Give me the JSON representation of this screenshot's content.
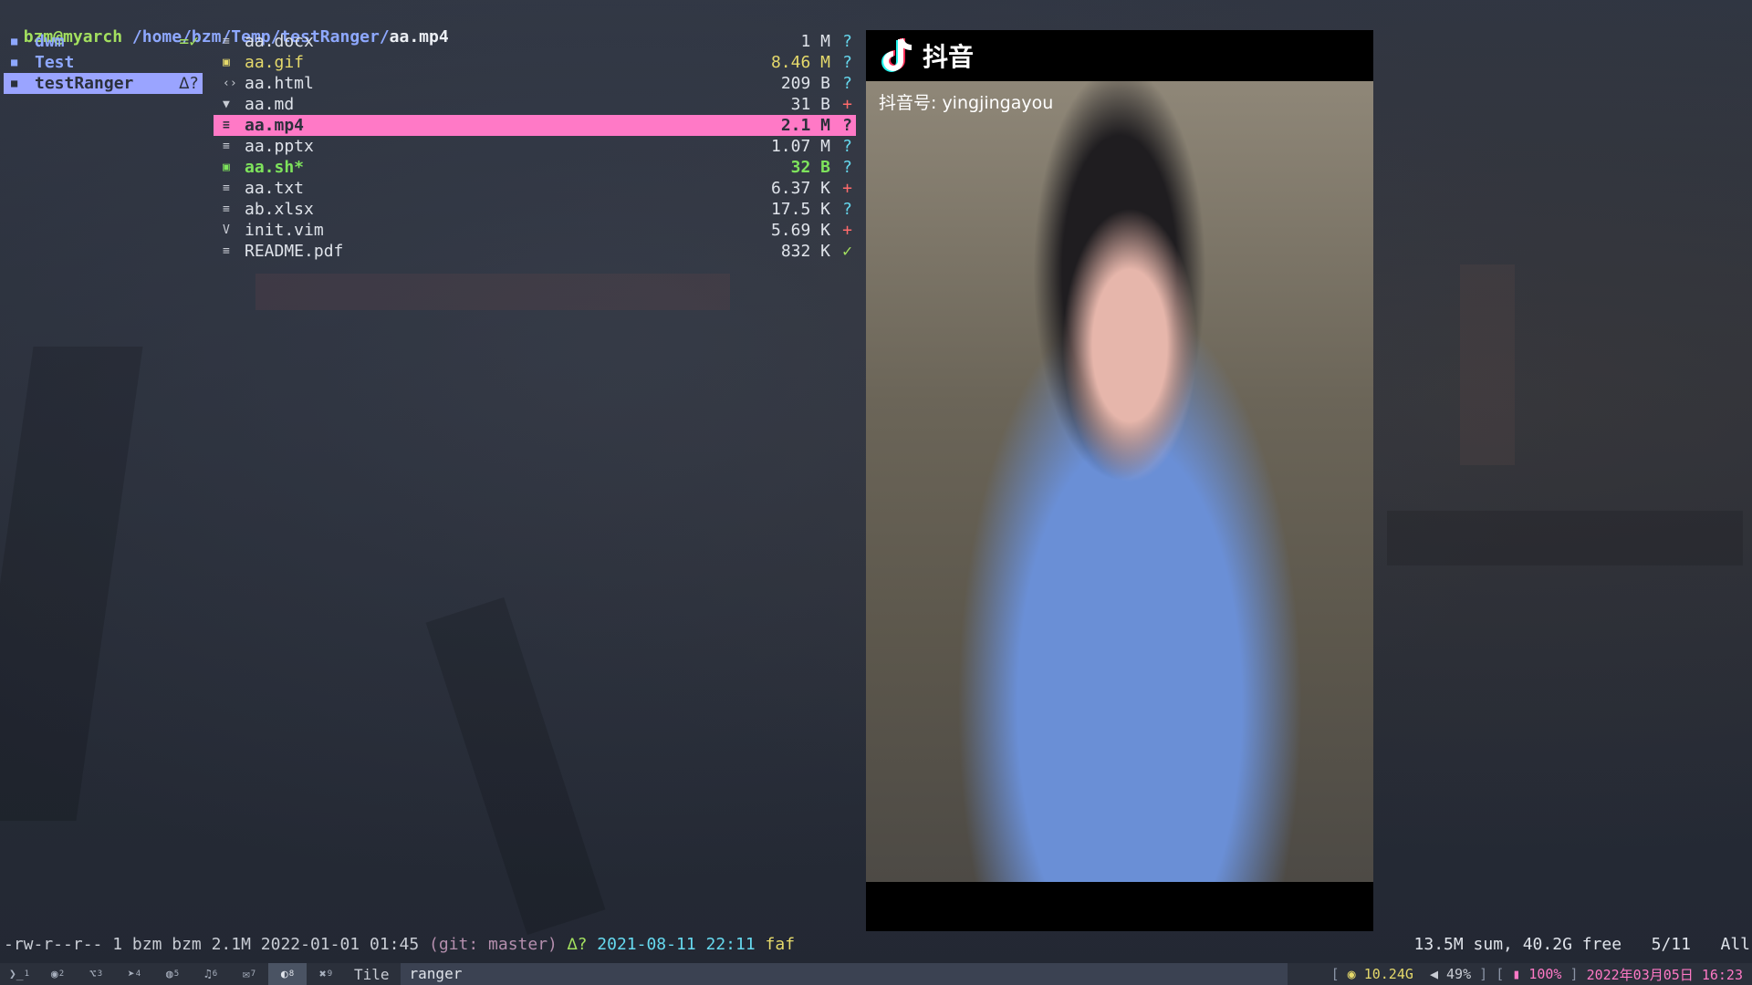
{
  "titlebar": {
    "user_host": "bzm@myarch",
    "dir_path": "/home/bzm/Temp/testRanger/",
    "current_file": "aa.mp4"
  },
  "parent_column": [
    {
      "name": "dwm",
      "tag": "=✓",
      "icon": "folder-icon"
    },
    {
      "name": "Test",
      "tag": "",
      "icon": "folder-icon"
    },
    {
      "name": "testRanger",
      "tag": "∆?",
      "icon": "folder-icon",
      "selected": true
    }
  ],
  "files": [
    {
      "name": "aa.docx",
      "size": "1 M",
      "git": "?",
      "icon": "document-icon"
    },
    {
      "name": "aa.gif",
      "size": "8.46 M",
      "git": "?",
      "icon": "image-icon",
      "style": "gif"
    },
    {
      "name": "aa.html",
      "size": "209 B",
      "git": "?",
      "icon": "code-icon"
    },
    {
      "name": "aa.md",
      "size": "31 B",
      "git": "+",
      "icon": "markdown-icon"
    },
    {
      "name": "aa.mp4",
      "size": "2.1 M",
      "git": "?",
      "icon": "video-icon",
      "selected": true
    },
    {
      "name": "aa.pptx",
      "size": "1.07 M",
      "git": "?",
      "icon": "document-icon"
    },
    {
      "name": "aa.sh*",
      "size": "32 B",
      "git": "?",
      "icon": "terminal-icon",
      "style": "exec"
    },
    {
      "name": "aa.txt",
      "size": "6.37 K",
      "git": "+",
      "icon": "document-icon"
    },
    {
      "name": "ab.xlsx",
      "size": "17.5 K",
      "git": "?",
      "icon": "document-icon"
    },
    {
      "name": "init.vim",
      "size": "5.69 K",
      "git": "+",
      "icon": "vim-icon"
    },
    {
      "name": "README.pdf",
      "size": "832 K",
      "git": "✓",
      "icon": "document-icon"
    }
  ],
  "preview": {
    "brand": "抖音",
    "account": "抖音号: yingjingayou"
  },
  "statusline": {
    "perms": "-rw-r--r--",
    "owner_info": "1 bzm bzm 2.1M 2022-01-01 01:45",
    "git_branch": "(git: master)",
    "git_status": "∆?",
    "git_date": "2021-08-11 22:11",
    "git_msg": "faf",
    "disk_info": "13.5M sum, 40.2G free",
    "position": "5/11",
    "scroll": "All"
  },
  "bar": {
    "tags": [
      {
        "icon": "terminal-icon",
        "glyph": "❯_",
        "num": "1"
      },
      {
        "icon": "chrome-icon",
        "glyph": "◉",
        "num": "2"
      },
      {
        "icon": "code-icon",
        "glyph": "⌥",
        "num": "3"
      },
      {
        "icon": "telegram-icon",
        "glyph": "➤",
        "num": "4"
      },
      {
        "icon": "wechat-icon",
        "glyph": "◍",
        "num": "5"
      },
      {
        "icon": "music-icon",
        "glyph": "♫",
        "num": "6"
      },
      {
        "icon": "chat-icon",
        "glyph": "✉",
        "num": "7"
      },
      {
        "icon": "ghost-icon",
        "glyph": "◐",
        "num": "8",
        "active": true
      },
      {
        "icon": "tool-icon",
        "glyph": "✖",
        "num": "9"
      }
    ],
    "layout": "Tile",
    "window_title": "ranger",
    "memory": "10.24G",
    "volume": "49%",
    "battery": "100%",
    "datetime": "2022年03月05日 16:23"
  },
  "colors": {
    "accent_selected": "#ff79c6",
    "parent_selected": "#9aa4ff",
    "dir_color": "#8ea8ff",
    "user_color": "#a3e05f"
  }
}
